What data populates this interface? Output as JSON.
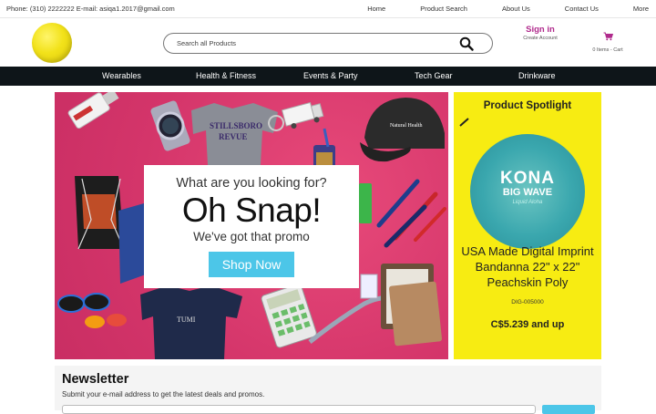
{
  "topbar": {
    "contact": "Phone: (310) 2222222 E-mail: asiqa1.2017@gmail.com",
    "links": [
      "Home",
      "Product Search",
      "About Us",
      "Contact Us",
      "More"
    ]
  },
  "header": {
    "search_placeholder": "Search all Products",
    "signin_label": "Sign in",
    "create_account_label": "Create Account",
    "cart_label": "0 Items - Cart"
  },
  "nav": {
    "items": [
      "Wearables",
      "Health & Fitness",
      "Events & Party",
      "Tech Gear",
      "Drinkware"
    ]
  },
  "hero": {
    "question": "What are you looking for?",
    "headline": "Oh Snap!",
    "subline": "We've got that promo",
    "cta": "Shop Now"
  },
  "spotlight": {
    "title": "Product Spotlight",
    "image_brand": "KONA",
    "image_sub": "BIG WAVE",
    "image_tag": "Liquid Aloha",
    "product_name": "USA Made Digital Imprint Bandanna 22\" x 22\" Peachskin Poly",
    "sku": "DIG-005000",
    "price": "C$5.239 and up"
  },
  "newsletter": {
    "title": "Newsletter",
    "description": "Submit your e-mail address to get the latest deals and promos."
  },
  "colors": {
    "nav_bg": "#0e1519",
    "hero_bg": "#d93a6a",
    "spotlight_bg": "#f7ec12",
    "accent": "#4cc6e8",
    "signin": "#b02a8c"
  }
}
